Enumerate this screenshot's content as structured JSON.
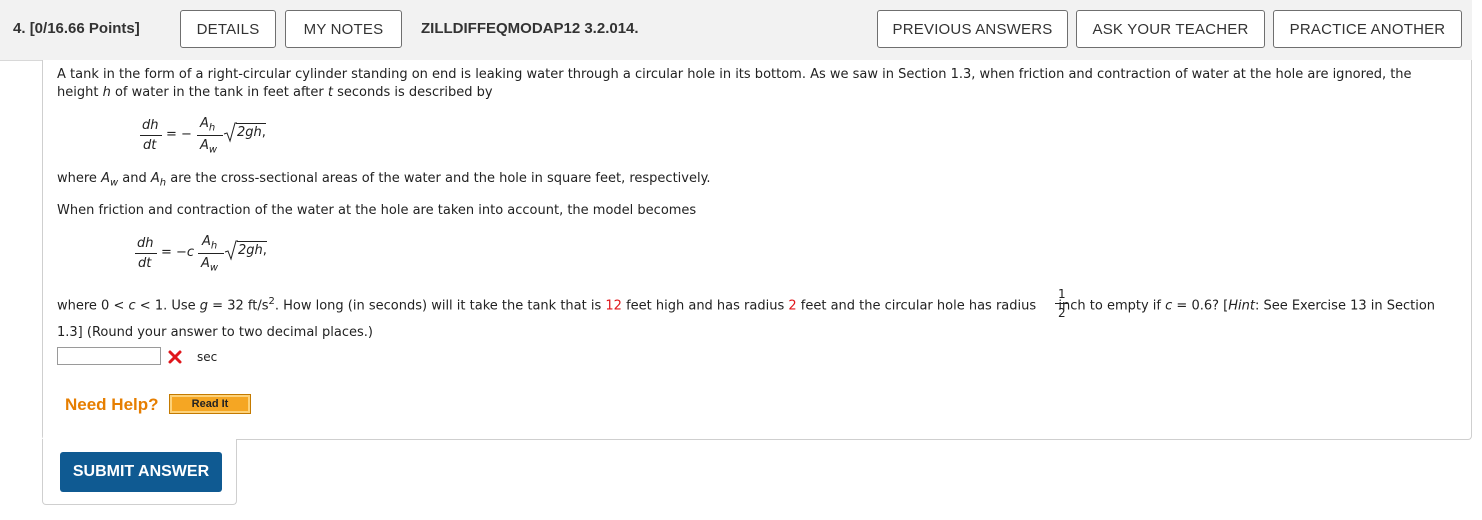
{
  "header": {
    "question_number": "4.",
    "points": "[0/16.66 Points]",
    "details_label": "DETAILS",
    "my_notes_label": "MY NOTES",
    "question_id": "ZILLDIFFEQMODAP12 3.2.014.",
    "previous_answers_label": "PREVIOUS ANSWERS",
    "ask_teacher_label": "ASK YOUR TEACHER",
    "practice_another_label": "PRACTICE ANOTHER"
  },
  "problem": {
    "intro_line1": "A tank in the form of a right-circular cylinder standing on end is leaking water through a circular hole in its bottom. As we saw in Section 1.3, when friction and contraction of water at the hole are ignored, the",
    "intro_line2_a": "height ",
    "intro_line2_h": "h",
    "intro_line2_b": " of water in the tank in feet after ",
    "intro_line2_t": "t",
    "intro_line2_c": " seconds is described by",
    "eq1": {
      "lhs_num": "dh",
      "lhs_den": "dt",
      "eq": "= −",
      "rhs_num": "A",
      "rhs_num_sub": "h",
      "rhs_den": "A",
      "rhs_den_sub": "w",
      "radicand": "2gh",
      "tail": ","
    },
    "where1_a": "where ",
    "where1_A": "A",
    "where1_sub_w": "w",
    "where1_b": " and ",
    "where1_A2": "A",
    "where1_sub_h": "h",
    "where1_c": " are the cross-sectional areas of the water and the hole in square feet, respectively.",
    "friction_line": "When friction and contraction of the water at the hole are taken into account, the model becomes",
    "eq2": {
      "lhs_num": "dh",
      "lhs_den": "dt",
      "eq": "= −",
      "coef": "c",
      "rhs_num": "A",
      "rhs_num_sub": "h",
      "rhs_den": "A",
      "rhs_den_sub": "w",
      "radicand": "2gh",
      "tail": ","
    },
    "where2_a": "where 0 < ",
    "where2_c": "c",
    "where2_b": " < 1. Use ",
    "where2_g": "g",
    "where2_c2": " = 32 ft/s",
    "where2_exp": "2",
    "where2_d": ". How long (in seconds) will it take the tank that is ",
    "height_value": "12",
    "where2_e": " feet high and has radius ",
    "radius_value": "2",
    "where2_f": " feet and the circular hole has radius ",
    "hole_num": "1",
    "hole_den": "2",
    "where2_g2": " inch to empty if ",
    "where2_cc": "c",
    "where2_h": " = 0.6? [",
    "hint_word": "Hint",
    "where2_i": ": See Exercise 13 in Section",
    "line_final": "1.3] (Round your answer to two decimal places.)"
  },
  "answer": {
    "value": "",
    "unit": "sec",
    "status_icon": "red-x-icon"
  },
  "help": {
    "need_help_label": "Need Help?",
    "read_it_label": "Read It"
  },
  "submit_label": "SUBMIT ANSWER",
  "colors": {
    "header_bg": "#f2f2f2",
    "given_value_red": "#e0161b",
    "need_help_orange": "#e67e00",
    "read_it_button": "#f5a623",
    "submit_blue": "#0f5a92"
  }
}
